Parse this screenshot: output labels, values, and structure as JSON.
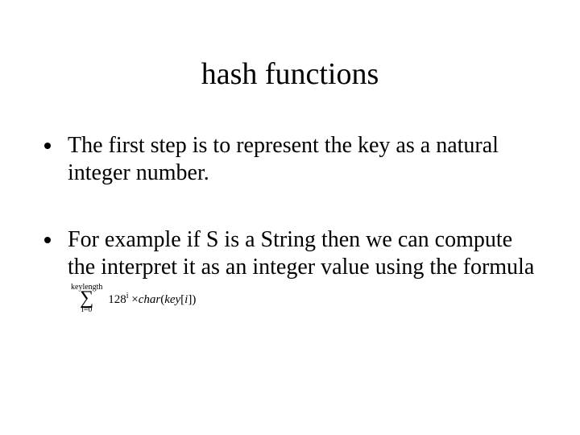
{
  "title": "hash functions",
  "bullets": [
    "The first step is to represent the key as a natural integer number.",
    "For example if S is a String then we can compute the interpret it as an integer value using the formula"
  ],
  "formula": {
    "upper": "keylength",
    "sigma": "∑",
    "lower": "i=0",
    "base": "128",
    "exponent": "i",
    "times": "×",
    "func": "char",
    "open": "(",
    "argword": "key",
    "bracket_open": "[",
    "index": "i",
    "bracket_close": "]",
    "close": ")"
  }
}
